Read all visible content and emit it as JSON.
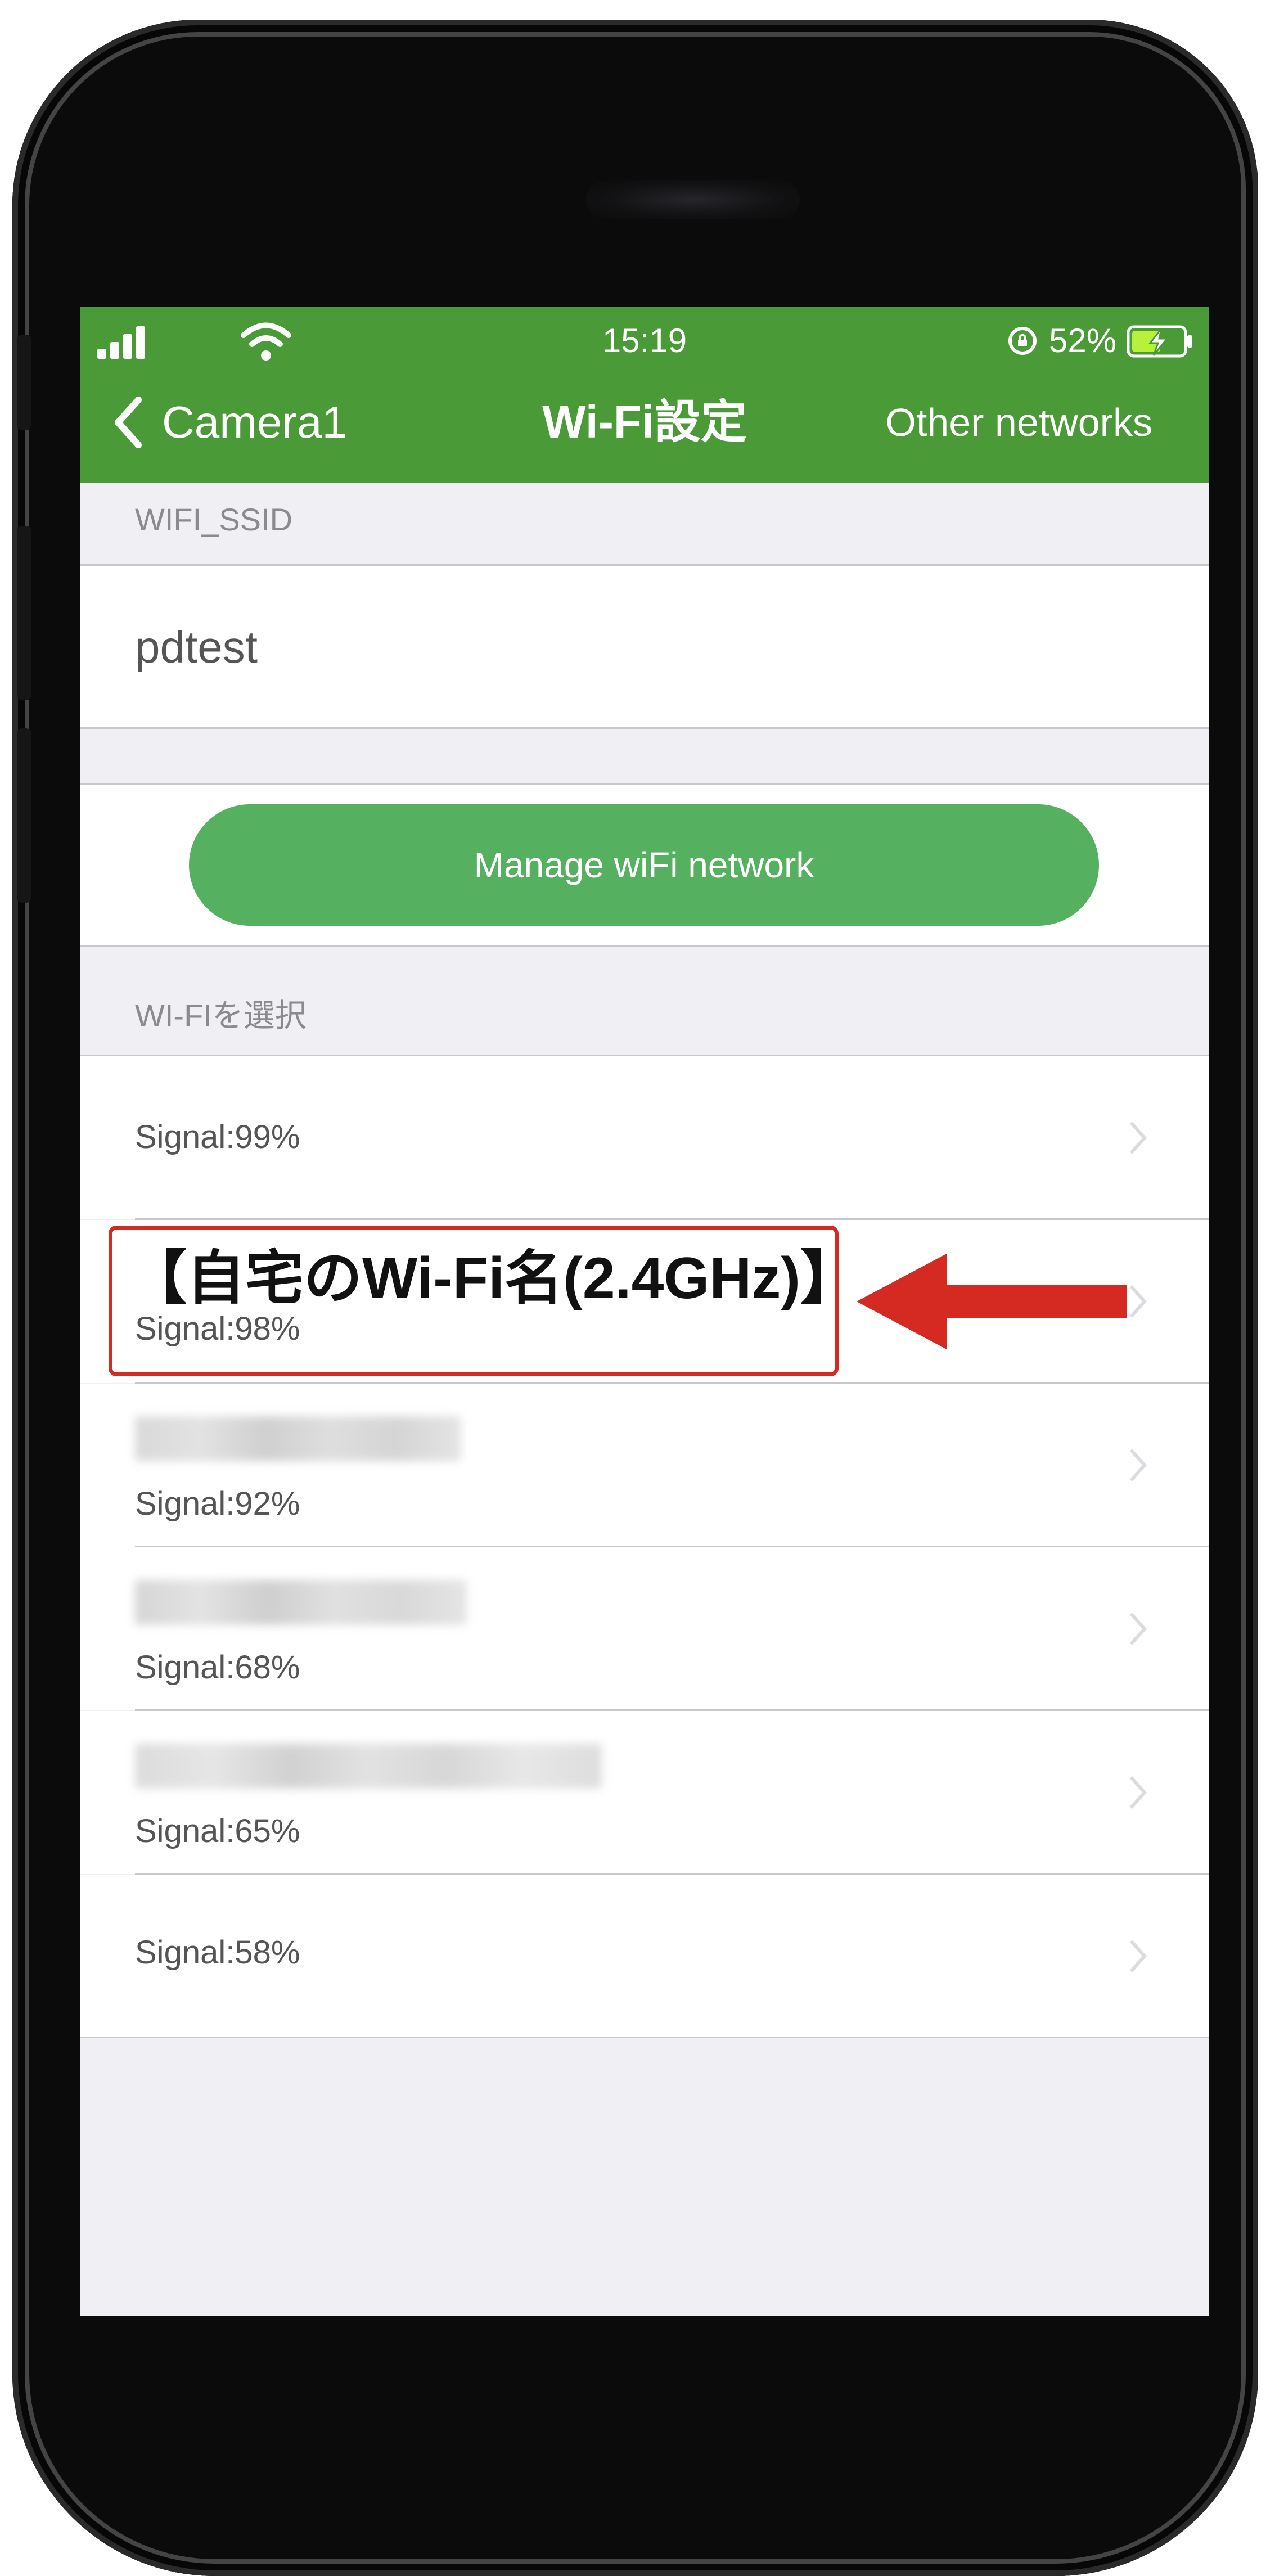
{
  "status_bar": {
    "time": "15:19",
    "battery": "52%"
  },
  "nav": {
    "back_label": "Camera1",
    "title": "Wi-Fi設定",
    "other_networks": "Other networks"
  },
  "ssid_section": {
    "label": "WIFI_SSID",
    "value": "pdtest"
  },
  "manage_button": "Manage wiFi network",
  "wifi_section": {
    "label": "WI-FIを選択"
  },
  "networks": [
    {
      "name": "",
      "signal": "Signal:99%"
    },
    {
      "name": "【自宅のWi-Fi名(2.4GHz)】",
      "signal": "Signal:98%"
    },
    {
      "name": "",
      "signal": "Signal:92%"
    },
    {
      "name": "",
      "signal": "Signal:68%"
    },
    {
      "name": "",
      "signal": "Signal:65%"
    },
    {
      "name": "",
      "signal": "Signal:58%"
    }
  ],
  "colors": {
    "header": "#4a9a37",
    "button": "#55b060",
    "highlight": "#d42a22"
  }
}
